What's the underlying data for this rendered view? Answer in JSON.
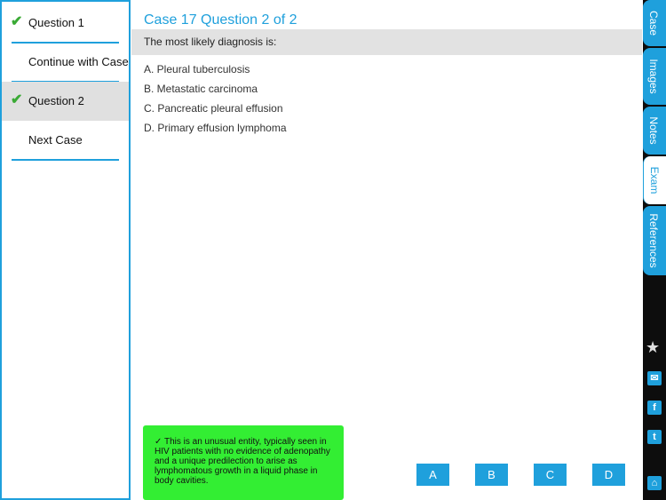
{
  "sidebar": {
    "items": [
      {
        "label": "Question 1",
        "check": "✔"
      },
      {
        "label": "Continue with Case",
        "check": ""
      },
      {
        "label": "Question 2",
        "check": "✔"
      },
      {
        "label": "Next Case",
        "check": ""
      }
    ]
  },
  "main": {
    "title": "Case 17 Question 2 of 2",
    "prompt": "The most likely diagnosis is:",
    "options": [
      "A. Pleural tuberculosis",
      "B. Metastatic carcinoma",
      "C. Pancreatic pleural effusion",
      "D. Primary effusion lymphoma"
    ],
    "feedback": "✓ This is an unusual entity, typically seen in HIV patients with no evidence of adenopathy and a unique predilection to arise as lymphomatous growth in a liquid phase in body cavities.",
    "answers": [
      "A",
      "B",
      "C",
      "D"
    ]
  },
  "rail": {
    "tabs": [
      "Case",
      "Images",
      "Notes",
      "Exam",
      "References"
    ],
    "active_tab": "Exam",
    "icons": {
      "star": "★",
      "mail": "✉",
      "facebook": "f",
      "tumblr": "t",
      "home": "⌂"
    }
  },
  "colors": {
    "accent": "#1fa0dc",
    "correct": "#33ee33",
    "check": "#3aaa35",
    "rail": "#0d0d0d"
  }
}
